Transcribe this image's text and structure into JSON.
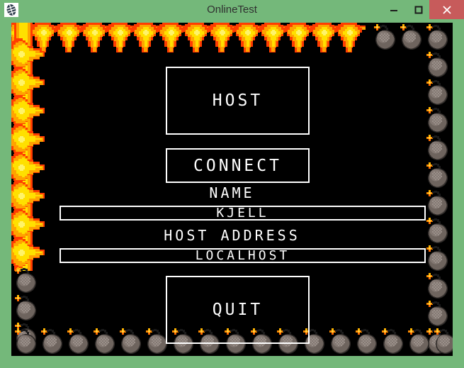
{
  "window": {
    "title": "OnlineTest",
    "icon": "app-window-icon",
    "frame_color": "#74b87a",
    "titlebar_text_color": "#2f2f2f",
    "controls": {
      "minimize": {
        "icon": "minimize-icon",
        "label": "–"
      },
      "maximize": {
        "icon": "maximize-icon",
        "label": "□"
      },
      "close": {
        "icon": "close-icon",
        "label": "✕",
        "color": "#c75b5b"
      }
    }
  },
  "game": {
    "background_color": "#000000",
    "menu": {
      "host_button": "HOST",
      "connect_button": "CONNECT",
      "quit_button": "QUIT",
      "name_label": "NAME",
      "name_value": "KJELL",
      "host_address_label": "HOST ADDRESS",
      "host_address_value": "LOCALHOST"
    },
    "sprites": {
      "flame": {
        "name": "explosion-flame-sprite",
        "core_color": "#ffe000",
        "mid_color": "#ffa300",
        "edge_color": "#ff3c00"
      },
      "bomb": {
        "name": "bomb-sprite",
        "body_color": "#7a7069",
        "highlight_color": "#9a908a",
        "shadow_color": "#4a4340",
        "fuse_color": "#ff8c00"
      }
    }
  }
}
